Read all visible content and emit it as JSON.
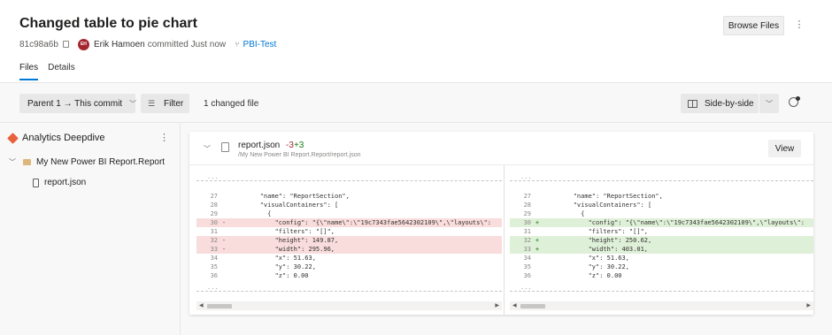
{
  "header": {
    "title": "Changed table to pie chart",
    "commit_hash": "81c98a6b",
    "avatar_initials": "EH",
    "author": "Erik Hamoen",
    "committed_text": "committed Just now",
    "branch": "PBI-Test",
    "browse_files_label": "Browse Files",
    "more_icon": "more-vertical-icon"
  },
  "tabs": [
    {
      "label": "Files",
      "active": true
    },
    {
      "label": "Details",
      "active": false
    }
  ],
  "toolbar": {
    "parent_label": "Parent 1 → This commit",
    "filter_label": "Filter",
    "changed_files": "1 changed file",
    "view_mode_label": "Side-by-side"
  },
  "sidebar": {
    "repo_name": "Analytics Deepdive",
    "folder_name": "My New Power BI Report.Report",
    "file_name": "report.json"
  },
  "diff": {
    "file_name": "report.json",
    "deletions": "-3",
    "additions": "+3",
    "file_path": "/My New Power BI Report.Report/report.json",
    "view_label": "View",
    "ellipsis": "...",
    "left_lines": [
      {
        "n": "27",
        "mark": "",
        "text": "        \"name\": \"ReportSection\",",
        "type": "ctx"
      },
      {
        "n": "28",
        "mark": "",
        "text": "        \"visualContainers\": [",
        "type": "ctx"
      },
      {
        "n": "29",
        "mark": "",
        "text": "          {",
        "type": "ctx"
      },
      {
        "n": "30",
        "mark": "-",
        "text": "            \"config\": \"{\\\"name\\\":\\\"19c7343fae5642302109\\\",\\\"layouts\\\":",
        "type": "del"
      },
      {
        "n": "31",
        "mark": "",
        "text": "            \"filters\": \"[]\",",
        "type": "ctx"
      },
      {
        "n": "32",
        "mark": "-",
        "text": "            \"height\": 149.87,",
        "type": "del"
      },
      {
        "n": "33",
        "mark": "-",
        "text": "            \"width\": 295.96,",
        "type": "del"
      },
      {
        "n": "34",
        "mark": "",
        "text": "            \"x\": 51.63,",
        "type": "ctx"
      },
      {
        "n": "35",
        "mark": "",
        "text": "            \"y\": 30.22,",
        "type": "ctx"
      },
      {
        "n": "36",
        "mark": "",
        "text": "            \"z\": 0.00",
        "type": "ctx"
      }
    ],
    "right_lines": [
      {
        "n": "27",
        "mark": "",
        "text": "        \"name\": \"ReportSection\",",
        "type": "ctx"
      },
      {
        "n": "28",
        "mark": "",
        "text": "        \"visualContainers\": [",
        "type": "ctx"
      },
      {
        "n": "29",
        "mark": "",
        "text": "          {",
        "type": "ctx"
      },
      {
        "n": "30",
        "mark": "+",
        "text": "            \"config\": \"{\\\"name\\\":\\\"19c7343fae5642302109\\\",\\\"layouts\\\":",
        "type": "add"
      },
      {
        "n": "31",
        "mark": "",
        "text": "            \"filters\": \"[]\",",
        "type": "ctx"
      },
      {
        "n": "32",
        "mark": "+",
        "text": "            \"height\": 250.62,",
        "type": "add"
      },
      {
        "n": "33",
        "mark": "+",
        "text": "            \"width\": 403.01,",
        "type": "add"
      },
      {
        "n": "34",
        "mark": "",
        "text": "            \"x\": 51.63,",
        "type": "ctx"
      },
      {
        "n": "35",
        "mark": "",
        "text": "            \"y\": 30.22,",
        "type": "ctx"
      },
      {
        "n": "36",
        "mark": "",
        "text": "            \"z\": 0.00",
        "type": "ctx"
      }
    ]
  },
  "colors": {
    "accent": "#0078d4",
    "deletion": "#a4262c",
    "addition": "#107c10",
    "del_bg": "#f9dcdc",
    "add_bg": "#dff0d8",
    "repo_icon": "#e8603c"
  }
}
